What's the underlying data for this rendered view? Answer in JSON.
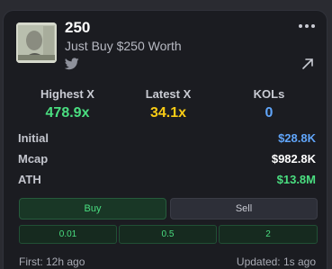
{
  "token": {
    "name": "250",
    "description": "Just Buy $250 Worth",
    "twitter_icon": "twitter-icon",
    "menu_icon": "more-dots-icon",
    "link_icon": "external-link-icon"
  },
  "stats": [
    {
      "label": "Highest X",
      "value": "478.9x",
      "color": "#4ade80"
    },
    {
      "label": "Latest X",
      "value": "34.1x",
      "color": "#facc15"
    },
    {
      "label": "KOLs",
      "value": "0",
      "color": "#60a5fa"
    }
  ],
  "metrics": [
    {
      "label": "Initial",
      "value": "$28.8K",
      "color": "#60a5fa"
    },
    {
      "label": "Mcap",
      "value": "$982.8K",
      "color": "#ffffff"
    },
    {
      "label": "ATH",
      "value": "$13.8M",
      "color": "#4ade80"
    }
  ],
  "actions": {
    "buy": "Buy",
    "sell": "Sell"
  },
  "amounts": [
    "0.01",
    "0.5",
    "2"
  ],
  "footer": {
    "first": "First: 12h ago",
    "updated": "Updated: 1s ago"
  }
}
